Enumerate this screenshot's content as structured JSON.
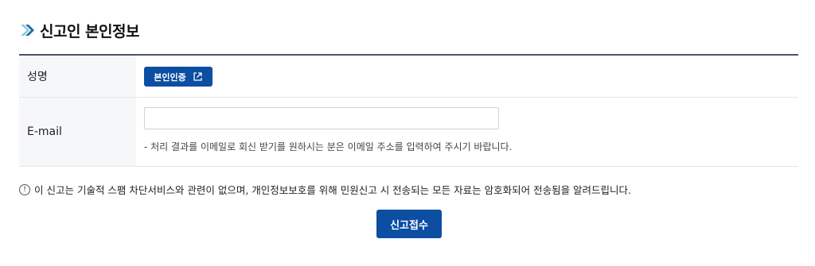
{
  "section": {
    "title": "신고인 본인정보",
    "icon": "chevron-logo-icon"
  },
  "form": {
    "name": {
      "label": "성명",
      "verify_button_label": "본인인증",
      "verify_icon": "external-link-icon"
    },
    "email": {
      "label": "E-mail",
      "value": "",
      "placeholder": "",
      "hint": "- 처리 결과를 이메일로 회신 받기를 원하시는 분은 이메일 주소를 입력하여 주시기 바랍니다."
    }
  },
  "notice": {
    "icon": "info-circle-icon",
    "icon_glyph": "!",
    "text": "이 신고는 기술적 스팸 차단서비스와 관련이 없으며, 개인정보보호를 위해 민원신고 시 전송되는 모든 자료는 암호화되어 전송됨을 알려드립니다."
  },
  "submit": {
    "label": "신고접수"
  },
  "colors": {
    "primary": "#0b4ea2",
    "logo_light": "#7fc4e8",
    "logo_dark": "#1f6b9e",
    "label_bg": "#f6f7f9"
  }
}
